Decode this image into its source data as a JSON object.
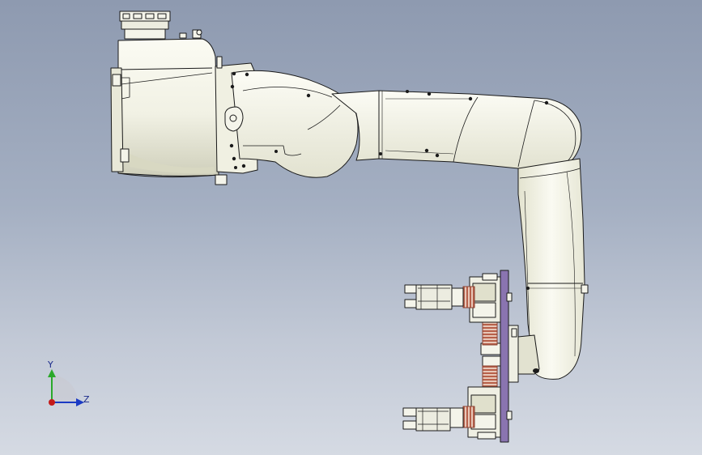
{
  "viewport": {
    "background_top": "#8e9ab0",
    "background_bottom": "#d5dae3"
  },
  "model": {
    "body_fill": "#f4f4ea",
    "shade_fill": "#dcdcc8",
    "edge_color": "#1a1a1a",
    "spring_color": "#b7604a",
    "plate_color": "#8a74b0"
  },
  "triad": {
    "x_color": "#c41a1a",
    "y_color": "#2aa82a",
    "z_color": "#1a3ac4",
    "y_label": "Y",
    "z_label": "Z"
  }
}
